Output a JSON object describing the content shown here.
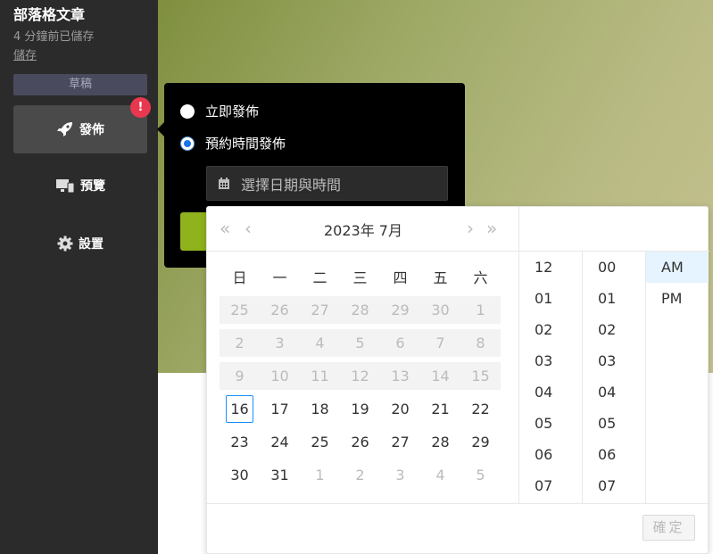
{
  "sidebar": {
    "doc_title": "部落格文章",
    "save_status": "4 分鐘前已儲存",
    "save_link": "儲存",
    "draft_badge": "草稿",
    "alert_badge": "!",
    "items": [
      {
        "label": "發佈",
        "icon": "rocket-icon"
      },
      {
        "label": "預覽",
        "icon": "monitor-icon"
      },
      {
        "label": "設置",
        "icon": "gear-icon"
      }
    ]
  },
  "publish": {
    "option_now": "立即發佈",
    "option_schedule": "預約時間發佈",
    "selected": "schedule",
    "date_placeholder": "選擇日期與時間"
  },
  "picker": {
    "title": "2023年  7月",
    "nav": {
      "prev_year": "«",
      "prev": "‹",
      "next": "›",
      "next_year": "»"
    },
    "weekdays": [
      "日",
      "一",
      "二",
      "三",
      "四",
      "五",
      "六"
    ],
    "weeks": [
      {
        "disabled": true,
        "days": [
          {
            "d": "25",
            "muted": true
          },
          {
            "d": "26",
            "muted": true
          },
          {
            "d": "27",
            "muted": true
          },
          {
            "d": "28",
            "muted": true
          },
          {
            "d": "29",
            "muted": true
          },
          {
            "d": "30",
            "muted": true
          },
          {
            "d": "1",
            "muted": true
          }
        ]
      },
      {
        "disabled": true,
        "days": [
          {
            "d": "2",
            "muted": true
          },
          {
            "d": "3",
            "muted": true
          },
          {
            "d": "4",
            "muted": true
          },
          {
            "d": "5",
            "muted": true
          },
          {
            "d": "6",
            "muted": true
          },
          {
            "d": "7",
            "muted": true
          },
          {
            "d": "8",
            "muted": true
          }
        ]
      },
      {
        "disabled": true,
        "days": [
          {
            "d": "9",
            "muted": true
          },
          {
            "d": "10",
            "muted": true
          },
          {
            "d": "11",
            "muted": true
          },
          {
            "d": "12",
            "muted": true
          },
          {
            "d": "13",
            "muted": true
          },
          {
            "d": "14",
            "muted": true
          },
          {
            "d": "15",
            "muted": true
          }
        ]
      },
      {
        "disabled": false,
        "days": [
          {
            "d": "16",
            "today": true
          },
          {
            "d": "17"
          },
          {
            "d": "18"
          },
          {
            "d": "19"
          },
          {
            "d": "20"
          },
          {
            "d": "21"
          },
          {
            "d": "22"
          }
        ]
      },
      {
        "disabled": false,
        "days": [
          {
            "d": "23"
          },
          {
            "d": "24"
          },
          {
            "d": "25"
          },
          {
            "d": "26"
          },
          {
            "d": "27"
          },
          {
            "d": "28"
          },
          {
            "d": "29"
          }
        ]
      },
      {
        "disabled": false,
        "days": [
          {
            "d": "30"
          },
          {
            "d": "31"
          },
          {
            "d": "1",
            "muted": true
          },
          {
            "d": "2",
            "muted": true
          },
          {
            "d": "3",
            "muted": true
          },
          {
            "d": "4",
            "muted": true
          },
          {
            "d": "5",
            "muted": true
          }
        ]
      }
    ],
    "hours": [
      "12",
      "01",
      "02",
      "03",
      "04",
      "05",
      "06",
      "07"
    ],
    "minutes": [
      "00",
      "01",
      "02",
      "03",
      "04",
      "05",
      "06",
      "07"
    ],
    "ampm": [
      {
        "label": "AM",
        "selected": true
      },
      {
        "label": "PM",
        "selected": false
      }
    ],
    "ok_label": "確定"
  },
  "colors": {
    "sidebar_bg": "#2b2b2b",
    "alert": "#e8384f",
    "accent": "#1a73e8",
    "publish_green": "#8fb21d"
  }
}
